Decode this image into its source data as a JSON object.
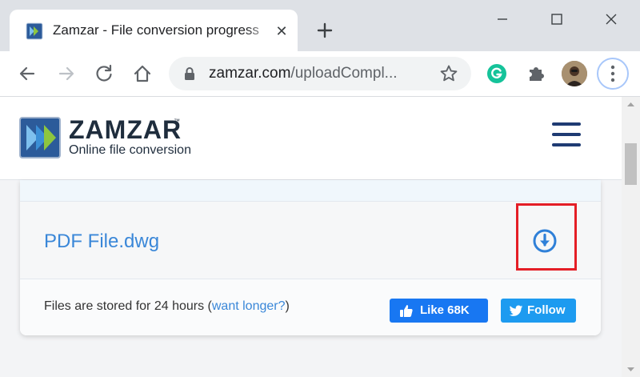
{
  "browser": {
    "tab_title": "Zamzar - File conversion progress",
    "url_domain": "zamzar.com",
    "url_path": "/uploadCompl...",
    "accent": "#a8c7fa"
  },
  "site": {
    "logo_name": "ZAMZAR",
    "logo_tm": "™",
    "logo_tagline": "Online file conversion"
  },
  "file": {
    "name": "PDF File.dwg",
    "highlight_color": "#e41e26"
  },
  "footer": {
    "stored_text": "Files are stored for 24 hours (",
    "longer_link": "want longer?",
    "closing": ")",
    "like_label": "Like 68K",
    "follow_label": "Follow"
  },
  "icons": [
    "zamzar-favicon-icon",
    "close-icon",
    "plus-icon",
    "minimize-icon",
    "maximize-icon",
    "window-close-icon",
    "back-arrow-icon",
    "forward-arrow-icon",
    "reload-icon",
    "home-icon",
    "lock-icon",
    "star-icon",
    "grammarly-icon",
    "extensions-puzzle-icon",
    "kebab-menu-icon",
    "hamburger-menu-icon",
    "download-icon",
    "thumbs-up-icon",
    "twitter-bird-icon"
  ]
}
